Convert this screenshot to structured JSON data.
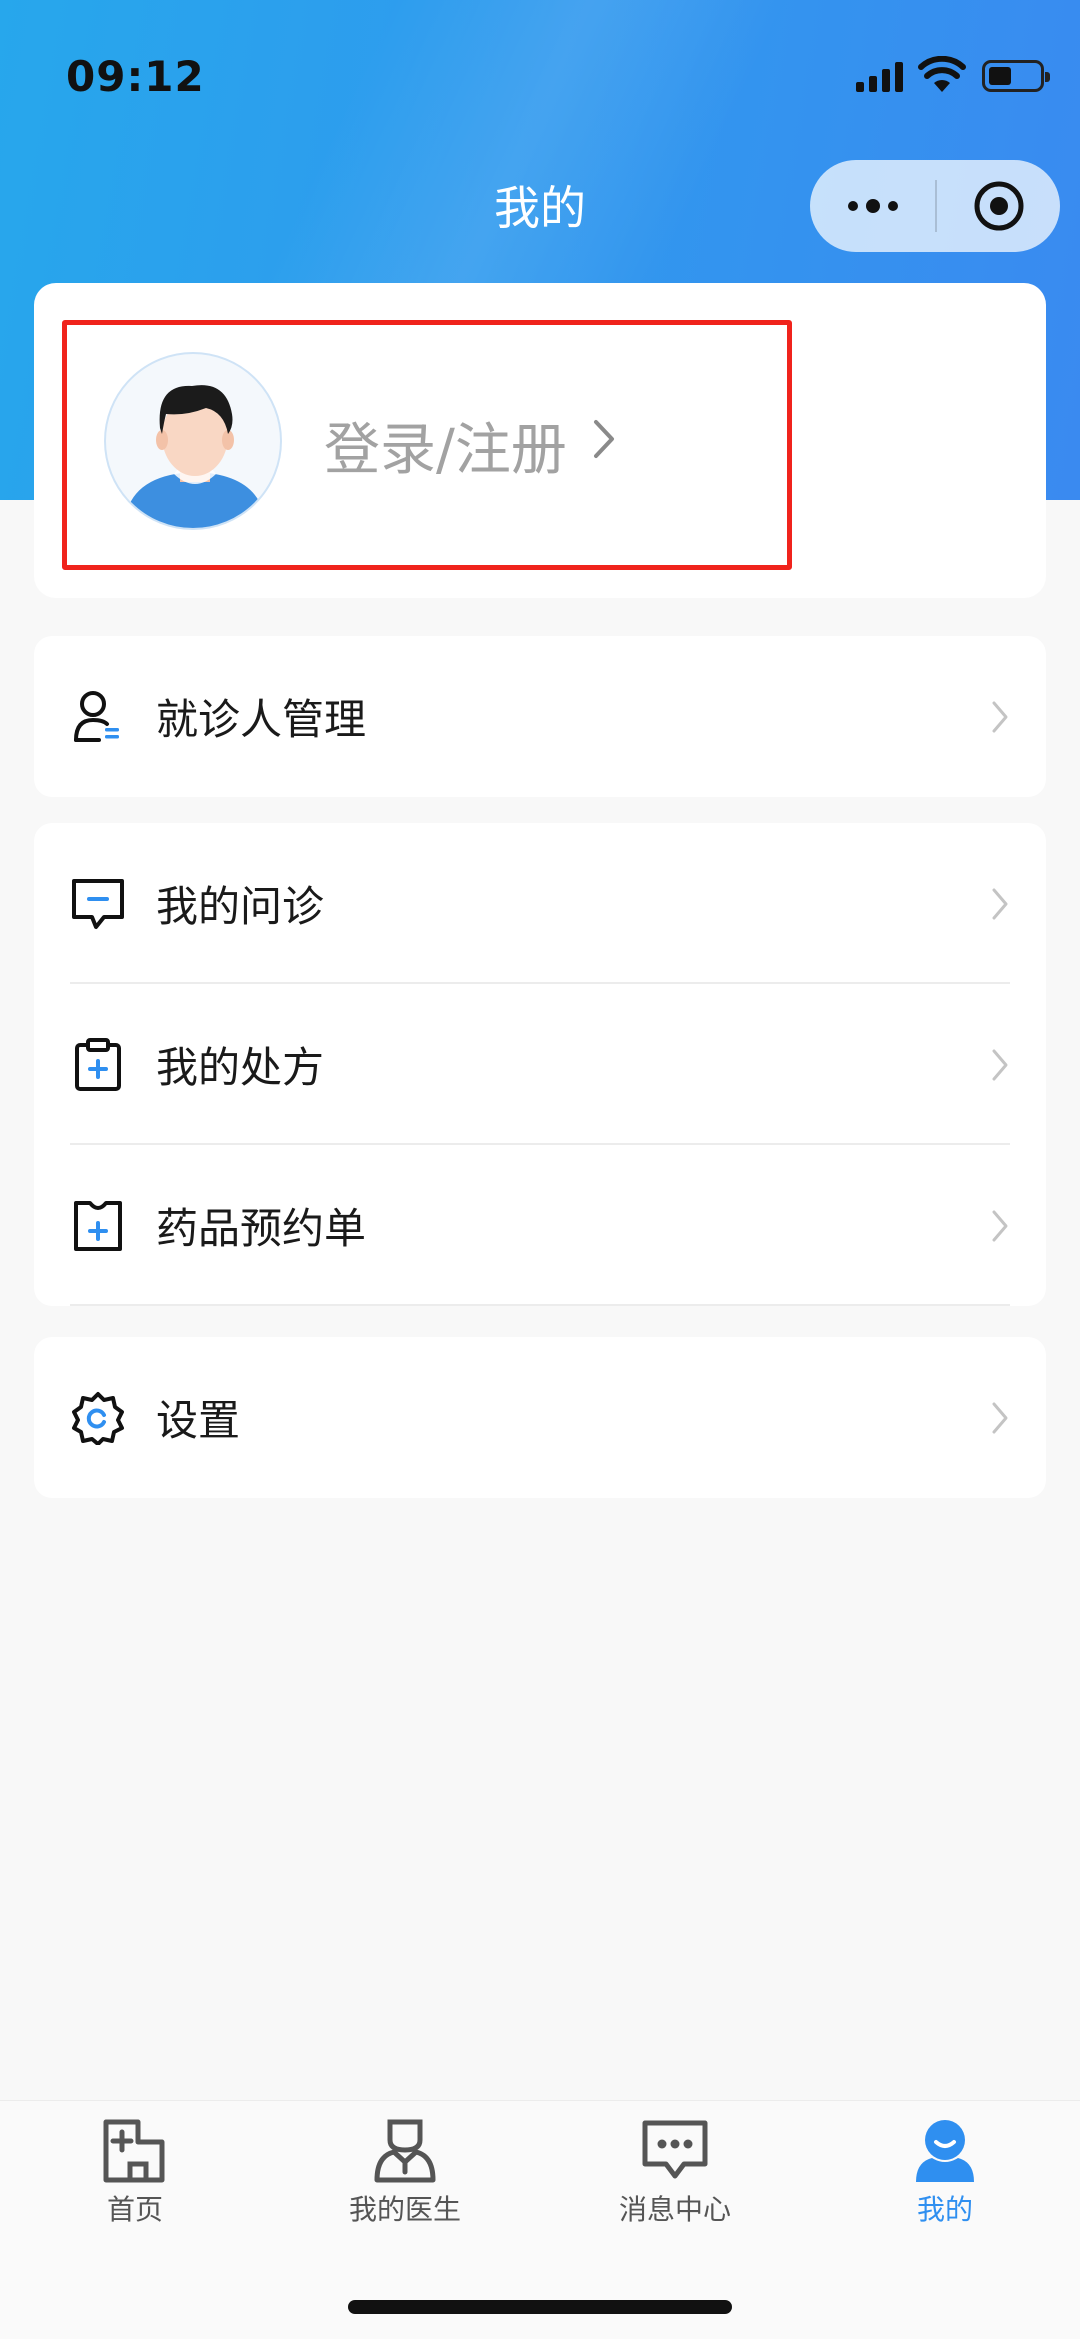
{
  "status_bar": {
    "time": "09:12"
  },
  "header": {
    "title": "我的"
  },
  "profile": {
    "login_label": "登录/注册"
  },
  "menu": {
    "group1": [
      {
        "label": "就诊人管理",
        "icon": "patient-manage-icon"
      }
    ],
    "group2": [
      {
        "label": "我的问诊",
        "icon": "consultation-icon"
      },
      {
        "label": "我的处方",
        "icon": "prescription-icon"
      },
      {
        "label": "药品预约单",
        "icon": "medicine-order-icon"
      }
    ],
    "group3": [
      {
        "label": "设置",
        "icon": "settings-icon"
      }
    ]
  },
  "tabbar": {
    "items": [
      {
        "label": "首页",
        "icon": "home-icon"
      },
      {
        "label": "我的医生",
        "icon": "doctor-icon"
      },
      {
        "label": "消息中心",
        "icon": "message-icon"
      },
      {
        "label": "我的",
        "icon": "profile-icon"
      }
    ],
    "active_index": 3
  },
  "colors": {
    "accent": "#2f8ff0",
    "highlight_border": "#f0231c",
    "header_gradient_start": "#27a7ec",
    "header_gradient_end": "#3a8af0"
  }
}
